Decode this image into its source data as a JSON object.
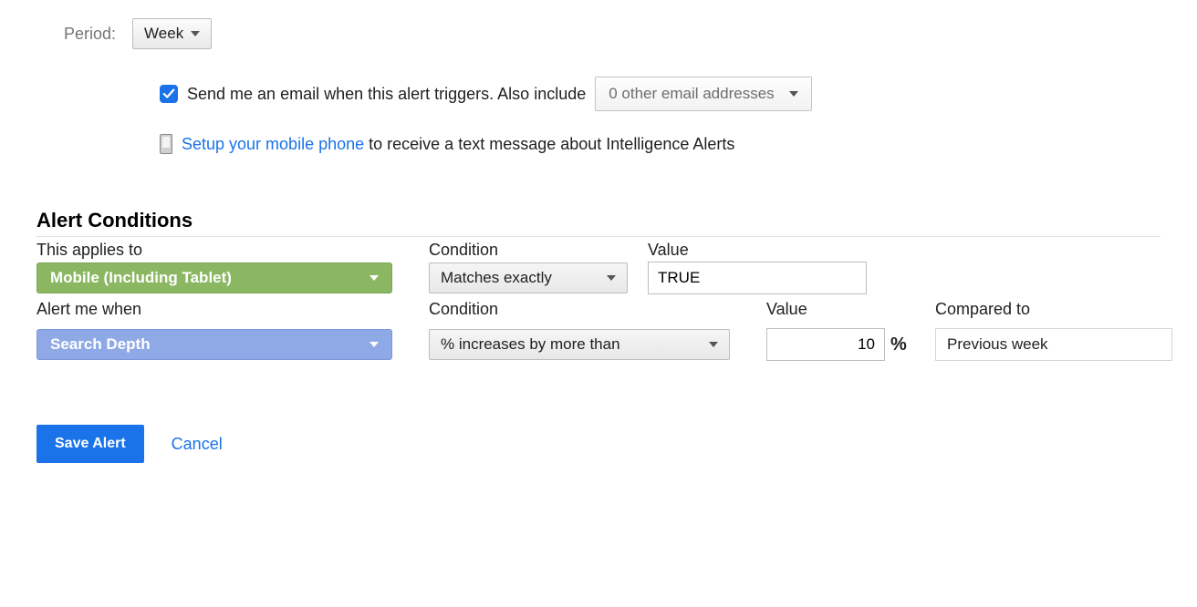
{
  "period": {
    "label": "Period:",
    "value": "Week"
  },
  "email": {
    "checked": true,
    "text": "Send me an email when this alert triggers. Also include",
    "other_addresses": "0 other email addresses"
  },
  "mobile": {
    "link_text": "Setup your mobile phone",
    "suffix": " to receive a text message about Intelligence Alerts"
  },
  "conditions": {
    "heading": "Alert Conditions",
    "row1": {
      "applies_to_label": "This applies to",
      "applies_to_value": "Mobile (Including Tablet)",
      "condition_label": "Condition",
      "condition_value": "Matches exactly",
      "value_label": "Value",
      "value_input": "TRUE"
    },
    "row2": {
      "alert_when_label": "Alert me when",
      "alert_when_value": "Search Depth",
      "condition_label": "Condition",
      "condition_value": "% increases by more than",
      "value_label": "Value",
      "value_input": "10",
      "percent": "%",
      "compared_label": "Compared to",
      "compared_value": "Previous week"
    }
  },
  "actions": {
    "save": "Save Alert",
    "cancel": "Cancel"
  }
}
